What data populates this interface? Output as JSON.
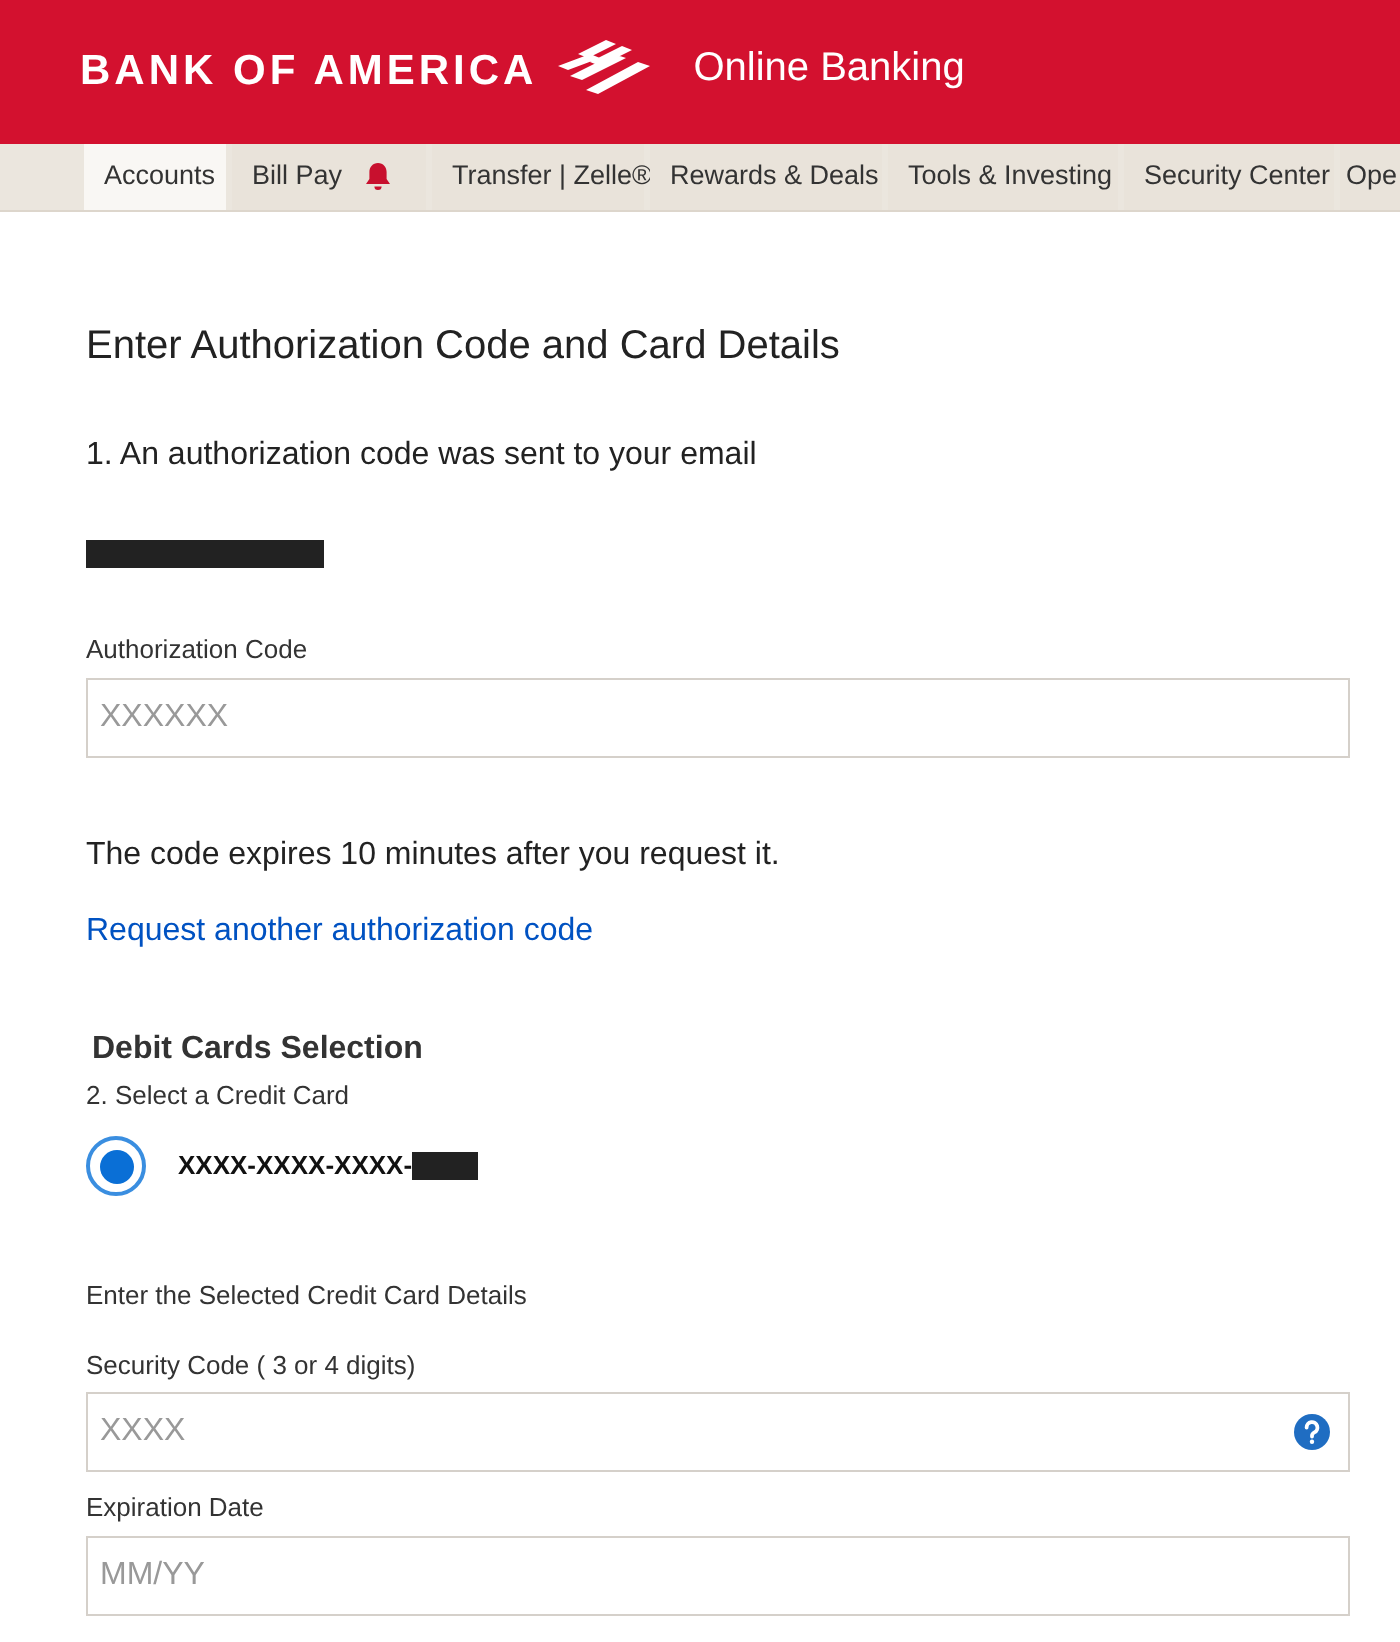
{
  "header": {
    "brand": "BANK OF AMERICA",
    "product": "Online Banking"
  },
  "nav": {
    "tabs": [
      {
        "label": "Accounts",
        "selected": true,
        "alert": false
      },
      {
        "label": "Bill Pay",
        "selected": false,
        "alert": true
      },
      {
        "label": "Transfer | Zelle®",
        "selected": false,
        "alert": false
      },
      {
        "label": "Rewards & Deals",
        "selected": false,
        "alert": false
      },
      {
        "label": "Tools & Investing",
        "selected": false,
        "alert": false
      },
      {
        "label": "Security Center",
        "selected": false,
        "alert": false
      },
      {
        "label": "Ope",
        "selected": false,
        "alert": false
      }
    ]
  },
  "title": "Enter Authorization Code and Card Details",
  "step1": "1. An authorization code was sent to your email",
  "auth_code": {
    "label": "Authorization Code",
    "placeholder": "XXXXXX"
  },
  "expiry_note": "The code expires 10 minutes after you request it.",
  "request_link": "Request another authorization code",
  "cards_heading": "Debit Cards Selection",
  "step2": "2. Select a Credit Card",
  "cards": [
    {
      "number": "XXXX-XXXX-XXXX-",
      "selected": true
    }
  ],
  "details_heading": "Enter the Selected Credit Card Details",
  "security_code": {
    "label": "Security Code ( 3 or 4 digits)",
    "placeholder": "XXXX"
  },
  "expiration": {
    "label": "Expiration Date",
    "placeholder": "MM/YY"
  }
}
